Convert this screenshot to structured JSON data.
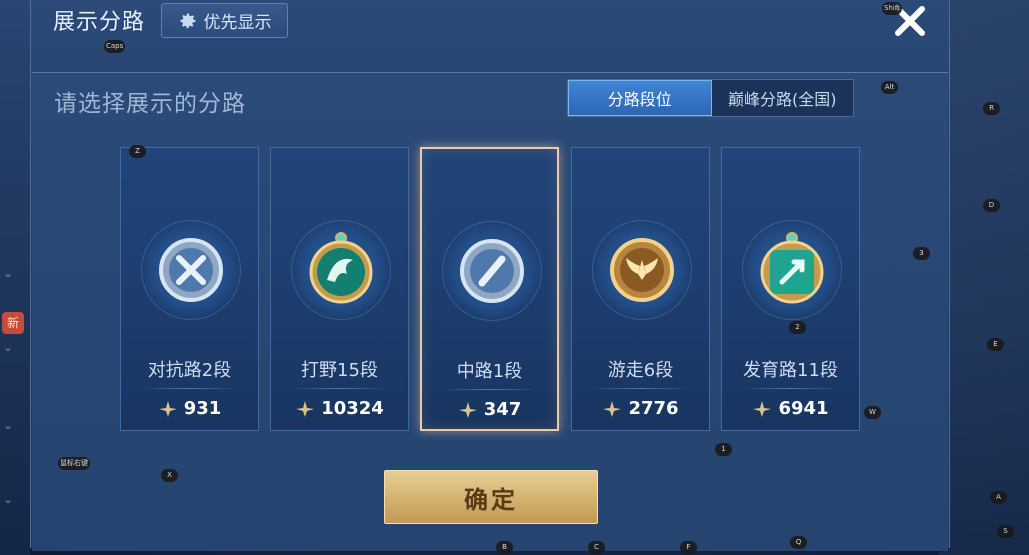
{
  "header": {
    "title": "展示分路",
    "priority_label": "优先显示"
  },
  "subtitle": "请选择展示的分路",
  "tabs": [
    {
      "label": "分路段位",
      "active": true
    },
    {
      "label": "巅峰分路(全国)",
      "active": false
    }
  ],
  "cards": [
    {
      "role": "对抗路2段",
      "score": "931",
      "emblem": "silver-sword-emblem",
      "selected": false
    },
    {
      "role": "打野15段",
      "score": "10324",
      "emblem": "jade-dragon-emblem",
      "selected": false
    },
    {
      "role": "中路1段",
      "score": "347",
      "emblem": "silver-staff-emblem",
      "selected": true
    },
    {
      "role": "游走6段",
      "score": "2776",
      "emblem": "gold-wings-emblem",
      "selected": false
    },
    {
      "role": "发育路11段",
      "score": "6941",
      "emblem": "jade-arrow-emblem",
      "selected": false
    }
  ],
  "confirm_label": "确定",
  "side_badge": "新",
  "key_hints": [
    {
      "label": "Shift"
    },
    {
      "label": "Caps"
    },
    {
      "label": "Alt"
    },
    {
      "label": "R"
    },
    {
      "label": "Z"
    },
    {
      "label": "D"
    },
    {
      "label": "3"
    },
    {
      "label": "2"
    },
    {
      "label": "E"
    },
    {
      "label": "W"
    },
    {
      "label": "1"
    },
    {
      "label": "鼠标右键"
    },
    {
      "label": "X"
    },
    {
      "label": "A"
    },
    {
      "label": "S"
    },
    {
      "label": "B"
    },
    {
      "label": "C"
    },
    {
      "label": "F"
    },
    {
      "label": "Q"
    }
  ],
  "colors": {
    "accent_blue": "#3f86d6",
    "gold": "#d5b472",
    "selected_border": "#e9c9a8"
  }
}
